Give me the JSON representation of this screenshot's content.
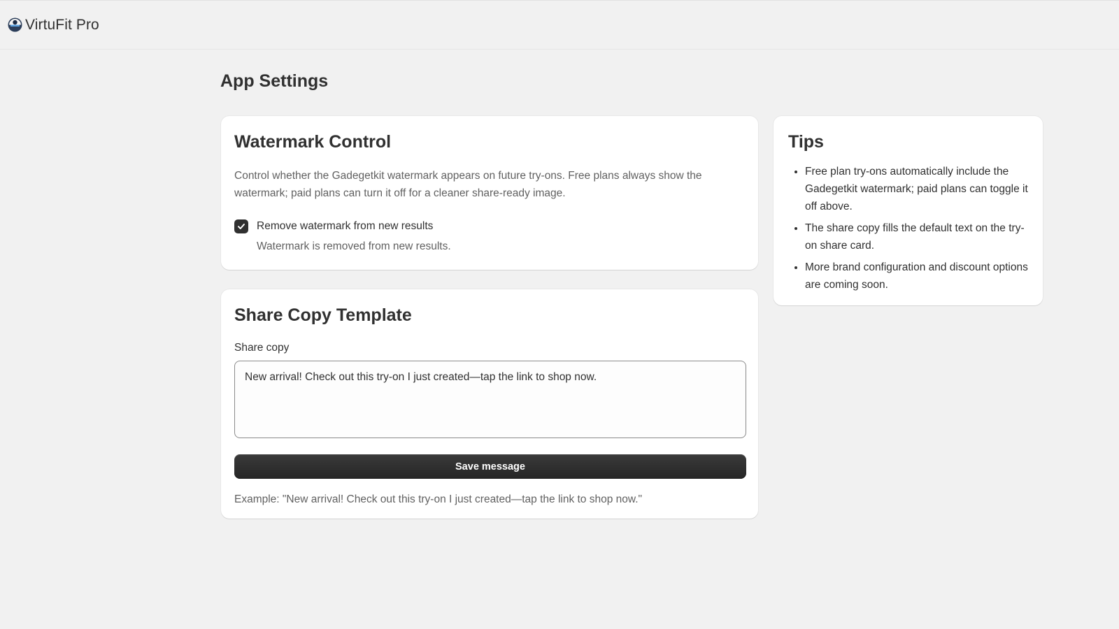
{
  "app": {
    "name": "VirtuFit Pro",
    "logo_icon": "app-logo-icon"
  },
  "page": {
    "title": "App Settings"
  },
  "watermark": {
    "title": "Watermark Control",
    "description": "Control whether the Gadegetkit watermark appears on future try-ons. Free plans always show the watermark; paid plans can turn it off for a cleaner share-ready image.",
    "checkbox_label": "Remove watermark from new results",
    "checkbox_checked": true,
    "checkbox_help": "Watermark is removed from new results."
  },
  "share": {
    "title": "Share Copy Template",
    "field_label": "Share copy",
    "value": "New arrival! Check out this try-on I just created—tap the link to shop now.",
    "save_label": "Save message",
    "example": "Example: \"New arrival! Check out this try-on I just created—tap the link to shop now.\""
  },
  "tips": {
    "title": "Tips",
    "items": [
      "Free plan try-ons automatically include the Gadegetkit watermark; paid plans can toggle it off above.",
      "The share copy fills the default text on the try-on share card.",
      "More brand configuration and discount options are coming soon."
    ]
  },
  "colors": {
    "background": "#f1f1f1",
    "card": "#ffffff",
    "text": "#303030",
    "muted_text": "#616161",
    "button": "#303030"
  }
}
